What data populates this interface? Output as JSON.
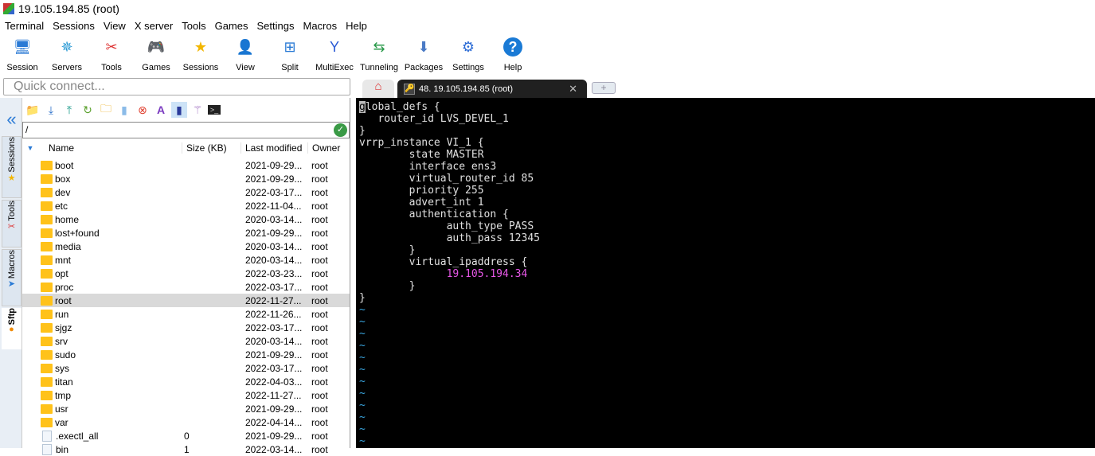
{
  "window": {
    "title": "19.105.194.85 (root)"
  },
  "menu": [
    "Terminal",
    "Sessions",
    "View",
    "X server",
    "Tools",
    "Games",
    "Settings",
    "Macros",
    "Help"
  ],
  "toolbar": [
    {
      "label": "Session",
      "icon": "session-icon"
    },
    {
      "label": "Servers",
      "icon": "servers-icon"
    },
    {
      "label": "Tools",
      "icon": "tools-icon"
    },
    {
      "label": "Games",
      "icon": "games-icon"
    },
    {
      "label": "Sessions",
      "icon": "star-icon"
    },
    {
      "label": "View",
      "icon": "view-icon"
    },
    {
      "label": "Split",
      "icon": "split-icon"
    },
    {
      "label": "MultiExec",
      "icon": "multiexec-icon"
    },
    {
      "label": "Tunneling",
      "icon": "tunneling-icon"
    },
    {
      "label": "Packages",
      "icon": "packages-icon"
    },
    {
      "label": "Settings",
      "icon": "settings-icon"
    },
    {
      "label": "Help",
      "icon": "help-icon"
    }
  ],
  "quick_connect": {
    "placeholder": "Quick connect..."
  },
  "side_tabs": [
    "Sessions",
    "Tools",
    "Macros",
    "Sftp"
  ],
  "sftp": {
    "path": "/",
    "columns": [
      "Name",
      "Size (KB)",
      "Last modified",
      "Owner"
    ],
    "rows": [
      {
        "name": "boot",
        "size": "",
        "modified": "2021-09-29...",
        "owner": "root",
        "type": "folder"
      },
      {
        "name": "box",
        "size": "",
        "modified": "2021-09-29...",
        "owner": "root",
        "type": "folder"
      },
      {
        "name": "dev",
        "size": "",
        "modified": "2022-03-17...",
        "owner": "root",
        "type": "folder"
      },
      {
        "name": "etc",
        "size": "",
        "modified": "2022-11-04...",
        "owner": "root",
        "type": "folder"
      },
      {
        "name": "home",
        "size": "",
        "modified": "2020-03-14...",
        "owner": "root",
        "type": "folder"
      },
      {
        "name": "lost+found",
        "size": "",
        "modified": "2021-09-29...",
        "owner": "root",
        "type": "folder"
      },
      {
        "name": "media",
        "size": "",
        "modified": "2020-03-14...",
        "owner": "root",
        "type": "folder"
      },
      {
        "name": "mnt",
        "size": "",
        "modified": "2020-03-14...",
        "owner": "root",
        "type": "folder"
      },
      {
        "name": "opt",
        "size": "",
        "modified": "2022-03-23...",
        "owner": "root",
        "type": "folder"
      },
      {
        "name": "proc",
        "size": "",
        "modified": "2022-03-17...",
        "owner": "root",
        "type": "folder"
      },
      {
        "name": "root",
        "size": "",
        "modified": "2022-11-27...",
        "owner": "root",
        "type": "folder",
        "selected": true
      },
      {
        "name": "run",
        "size": "",
        "modified": "2022-11-26...",
        "owner": "root",
        "type": "folder"
      },
      {
        "name": "sjgz",
        "size": "",
        "modified": "2022-03-17...",
        "owner": "root",
        "type": "folder"
      },
      {
        "name": "srv",
        "size": "",
        "modified": "2020-03-14...",
        "owner": "root",
        "type": "folder"
      },
      {
        "name": "sudo",
        "size": "",
        "modified": "2021-09-29...",
        "owner": "root",
        "type": "folder"
      },
      {
        "name": "sys",
        "size": "",
        "modified": "2022-03-17...",
        "owner": "root",
        "type": "folder"
      },
      {
        "name": "titan",
        "size": "",
        "modified": "2022-04-03...",
        "owner": "root",
        "type": "folder"
      },
      {
        "name": "tmp",
        "size": "",
        "modified": "2022-11-27...",
        "owner": "root",
        "type": "folder"
      },
      {
        "name": "usr",
        "size": "",
        "modified": "2021-09-29...",
        "owner": "root",
        "type": "folder"
      },
      {
        "name": "var",
        "size": "",
        "modified": "2022-04-14...",
        "owner": "root",
        "type": "folder"
      },
      {
        "name": ".exectl_all",
        "size": "0",
        "modified": "2021-09-29...",
        "owner": "root",
        "type": "file"
      },
      {
        "name": "bin",
        "size": "1",
        "modified": "2022-03-14...",
        "owner": "root",
        "type": "file"
      }
    ]
  },
  "tabs": {
    "active": "48. 19.105.194.85 (root)"
  },
  "terminal": {
    "lines": [
      "global_defs {",
      "   router_id LVS_DEVEL_1",
      "}",
      "vrrp_instance VI_1 {",
      "        state MASTER",
      "        interface ens3",
      "        virtual_router_id 85",
      "        priority 255",
      "        advert_int 1",
      "        authentication {",
      "              auth_type PASS",
      "              auth_pass 12345",
      "        }",
      "        virtual_ipaddress {",
      "              19.105.194.34",
      "        }",
      "}",
      "~",
      "~",
      "~",
      "~",
      "~",
      "~",
      "~",
      "~",
      "~",
      "~",
      "~",
      "~"
    ]
  }
}
